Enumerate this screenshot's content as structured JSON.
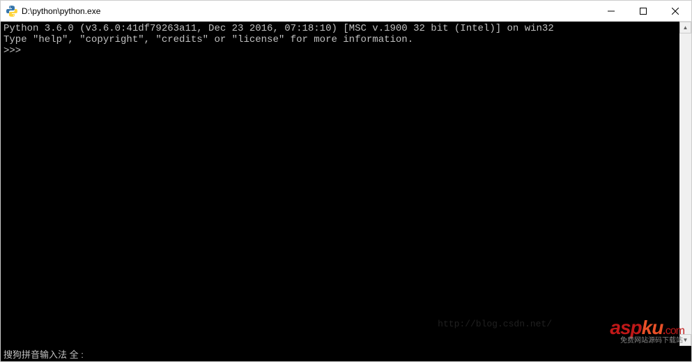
{
  "titlebar": {
    "title": "D:\\python\\python.exe"
  },
  "console": {
    "line1": "Python 3.6.0 (v3.6.0:41df79263a11, Dec 23 2016, 07:18:10) [MSC v.1900 32 bit (Intel)] on win32",
    "line2": "Type \"help\", \"copyright\", \"credits\" or \"license\" for more information.",
    "prompt": ">>>"
  },
  "ime": {
    "status": "搜狗拼音输入法 全 :"
  },
  "watermark": {
    "url": "http://blog.csdn.net/",
    "logo_asp": "asp",
    "logo_ku": "ku",
    "logo_dot": ".",
    "logo_com": "com",
    "sub": "免费网站源码下载站"
  }
}
